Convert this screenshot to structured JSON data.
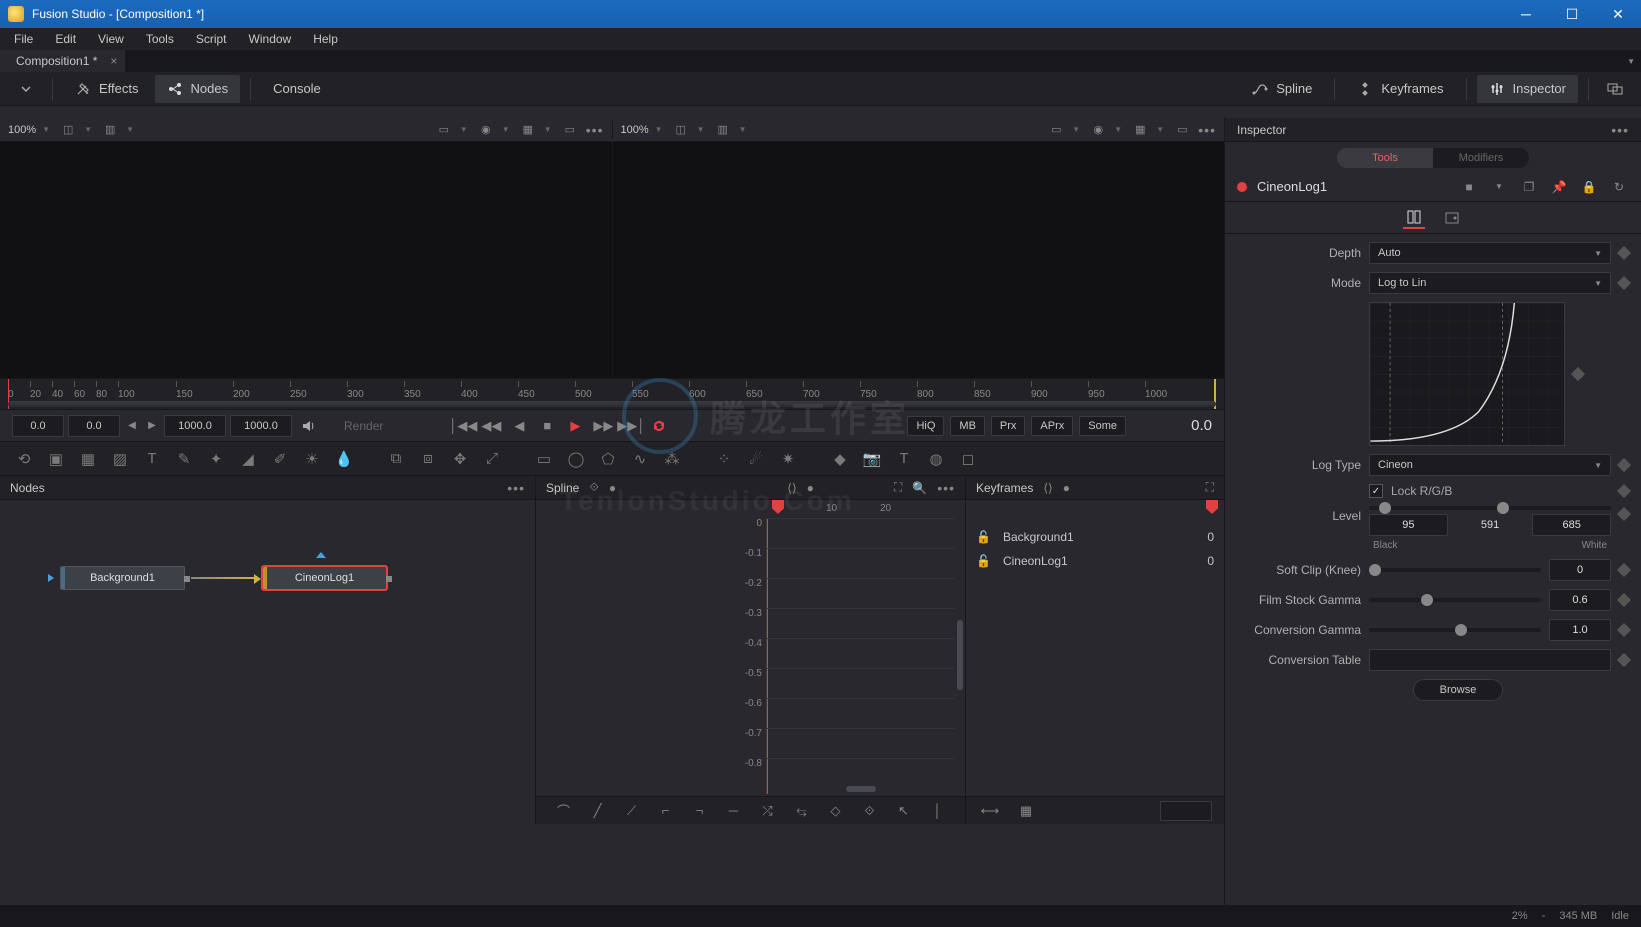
{
  "titlebar": {
    "title": "Fusion Studio - [Composition1 *]"
  },
  "menus": [
    "File",
    "Edit",
    "View",
    "Tools",
    "Script",
    "Window",
    "Help"
  ],
  "tab": {
    "label": "Composition1 *"
  },
  "main_toolbar": {
    "effects": "Effects",
    "nodes": "Nodes",
    "console": "Console",
    "spline": "Spline",
    "keyframes": "Keyframes",
    "inspector": "Inspector"
  },
  "viewer": {
    "left_zoom": "100%",
    "right_zoom": "100%"
  },
  "ruler_ticks": [
    "0",
    "20",
    "40",
    "60",
    "80",
    "100",
    "150",
    "200",
    "250",
    "300",
    "350",
    "400",
    "450",
    "500",
    "550",
    "600",
    "650",
    "700",
    "750",
    "800",
    "850",
    "900",
    "950",
    "1000"
  ],
  "transport": {
    "in": "0.0",
    "cur": "0.0",
    "range_a": "1000.0",
    "range_b": "1000.0",
    "render": "Render",
    "tags": [
      "HiQ",
      "MB",
      "Prx",
      "APrx",
      "Some"
    ],
    "time": "0.0"
  },
  "panels": {
    "nodes": {
      "title": "Nodes"
    },
    "spline": {
      "title": "Spline",
      "x_ticks": [
        "10",
        "20"
      ],
      "y_ticks": [
        "0",
        "-0.1",
        "-0.2",
        "-0.3",
        "-0.4",
        "-0.5",
        "-0.6",
        "-0.7",
        "-0.8"
      ]
    },
    "keyframes": {
      "title": "Keyframes",
      "rows": [
        {
          "name": "Background1",
          "val": "0"
        },
        {
          "name": "CineonLog1",
          "val": "0"
        }
      ]
    }
  },
  "nodes": {
    "bg": "Background1",
    "cineon": "CineonLog1"
  },
  "inspector": {
    "title": "Inspector",
    "tabs": {
      "tools": "Tools",
      "modifiers": "Modifiers"
    },
    "tool_name": "CineonLog1",
    "depth_label": "Depth",
    "depth_val": "Auto",
    "mode_label": "Mode",
    "mode_val": "Log to Lin",
    "logtype_label": "Log Type",
    "logtype_val": "Cineon",
    "lock_label": "Lock R/G/B",
    "level_label": "Level",
    "level_black": "95",
    "level_mid": "591",
    "level_white": "685",
    "black_label": "Black",
    "white_label": "White",
    "softclip_label": "Soft Clip (Knee)",
    "softclip_val": "0",
    "filmgamma_label": "Film Stock Gamma",
    "filmgamma_val": "0.6",
    "convgamma_label": "Conversion Gamma",
    "convgamma_val": "1.0",
    "convtable_label": "Conversion Table",
    "browse": "Browse"
  },
  "status": {
    "pct": "2%",
    "mem": "345 MB",
    "state": "Idle"
  }
}
